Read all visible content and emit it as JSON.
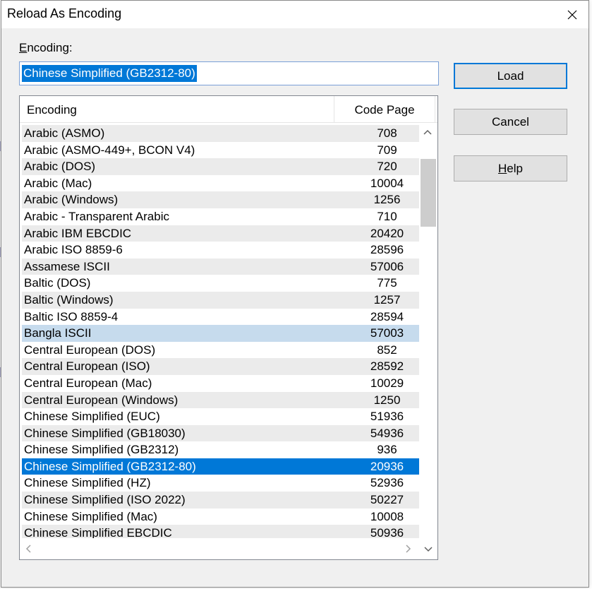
{
  "window": {
    "title": "Reload As Encoding"
  },
  "encoding_field": {
    "label_mnemonic": "E",
    "label_rest": "ncoding:",
    "value": "Chinese Simplified (GB2312-80)"
  },
  "list": {
    "columns": [
      "Encoding",
      "Code Page"
    ],
    "rows": [
      {
        "name": "Arabic (ASMO)",
        "code_page": "708"
      },
      {
        "name": "Arabic (ASMO-449+, BCON V4)",
        "code_page": "709"
      },
      {
        "name": "Arabic (DOS)",
        "code_page": "720"
      },
      {
        "name": "Arabic (Mac)",
        "code_page": "10004"
      },
      {
        "name": "Arabic (Windows)",
        "code_page": "1256"
      },
      {
        "name": "Arabic - Transparent Arabic",
        "code_page": "710"
      },
      {
        "name": "Arabic IBM EBCDIC",
        "code_page": "20420"
      },
      {
        "name": "Arabic ISO 8859-6",
        "code_page": "28596"
      },
      {
        "name": "Assamese ISCII",
        "code_page": "57006"
      },
      {
        "name": "Baltic (DOS)",
        "code_page": "775"
      },
      {
        "name": "Baltic (Windows)",
        "code_page": "1257"
      },
      {
        "name": "Baltic ISO 8859-4",
        "code_page": "28594"
      },
      {
        "name": "Bangla ISCII",
        "code_page": "57003",
        "state": "hover"
      },
      {
        "name": "Central European (DOS)",
        "code_page": "852"
      },
      {
        "name": "Central European (ISO)",
        "code_page": "28592"
      },
      {
        "name": "Central European (Mac)",
        "code_page": "10029"
      },
      {
        "name": "Central European (Windows)",
        "code_page": "1250"
      },
      {
        "name": "Chinese Simplified (EUC)",
        "code_page": "51936"
      },
      {
        "name": "Chinese Simplified (GB18030)",
        "code_page": "54936"
      },
      {
        "name": "Chinese Simplified (GB2312)",
        "code_page": "936"
      },
      {
        "name": "Chinese Simplified (GB2312-80)",
        "code_page": "20936",
        "state": "selected"
      },
      {
        "name": "Chinese Simplified (HZ)",
        "code_page": "52936"
      },
      {
        "name": "Chinese Simplified (ISO 2022)",
        "code_page": "50227"
      },
      {
        "name": "Chinese Simplified (Mac)",
        "code_page": "10008"
      },
      {
        "name": "Chinese Simplified EBCDIC",
        "code_page": "50936"
      }
    ]
  },
  "buttons": {
    "load": "Load",
    "cancel": "Cancel",
    "help_mnemonic": "H",
    "help_rest": "elp"
  },
  "colors": {
    "selection": "#0078d7",
    "hover": "#c6dbed",
    "alt_row": "#ebebeb",
    "dialog_bg": "#f0f0f0"
  }
}
